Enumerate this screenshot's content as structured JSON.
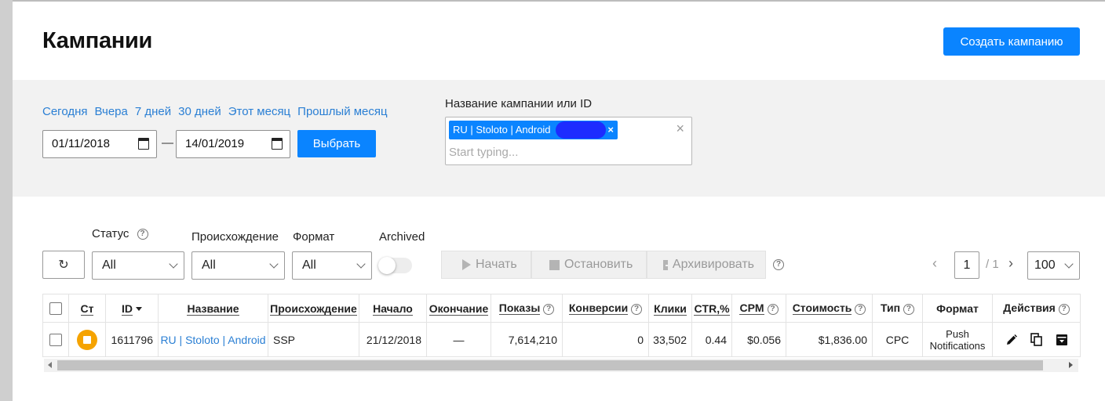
{
  "header": {
    "title": "Кампании",
    "create_button": "Создать кампанию"
  },
  "filters": {
    "quick_ranges": [
      "Сегодня",
      "Вчера",
      "7 дней",
      "30 дней",
      "Этот месяц",
      "Прошлый месяц"
    ],
    "date_from": "01/11/2018",
    "date_separator": "—",
    "date_to": "14/01/2019",
    "apply_button": "Выбрать",
    "search_label": "Название кампании или ID",
    "search_tag": "RU | Stoloto | Android",
    "search_placeholder": "Start typing..."
  },
  "toolbar": {
    "status_label": "Статус",
    "status_value": "All",
    "origin_label": "Происхождение",
    "origin_value": "All",
    "format_label": "Формат",
    "format_value": "All",
    "archived_label": "Archived",
    "archived_on": false,
    "start_button": "Начать",
    "stop_button": "Остановить",
    "archive_button": "Архивировать",
    "page_current": "1",
    "page_total": "/ 1",
    "per_page": "100"
  },
  "table": {
    "columns": [
      "Ст",
      "ID",
      "Название",
      "Происхождение",
      "Начало",
      "Окончание",
      "Показы",
      "Конверсии",
      "Клики",
      "CTR,%",
      "CPM",
      "Стоимость",
      "Тип",
      "Формат",
      "Действия"
    ],
    "rows": [
      {
        "status": "paused",
        "id": "1611796",
        "name": "RU | Stoloto | Android",
        "origin": "SSP",
        "start": "21/12/2018",
        "end": "—",
        "impressions": "7,614,210",
        "conversions": "0",
        "clicks": "33,502",
        "ctr": "0.44",
        "cpm": "$0.056",
        "cost": "$1,836.00",
        "type": "CPC",
        "format_line1": "Push",
        "format_line2": "Notifications"
      }
    ]
  },
  "icons": {
    "refresh": "refresh-icon",
    "edit": "pencil-icon",
    "copy": "copy-icon",
    "archive": "archive-icon",
    "help": "question-icon"
  },
  "colors": {
    "accent": "#0a84ff",
    "link": "#2a7fd4",
    "status_paused": "#f5a300"
  }
}
